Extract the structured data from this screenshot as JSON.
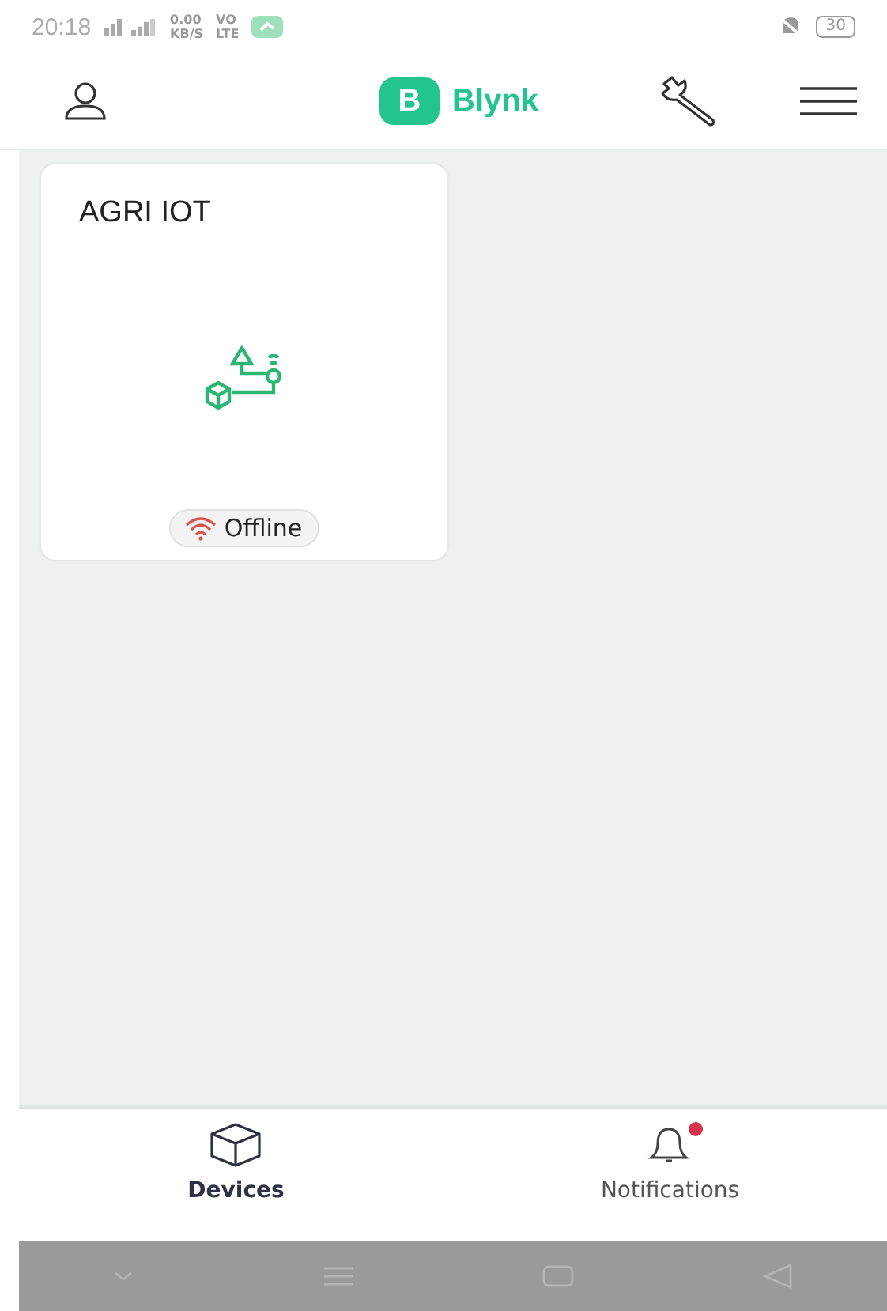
{
  "status_bar": {
    "time": "20:18",
    "speed": "0.00",
    "speed_unit": "KB/S",
    "volte": "VO",
    "volte_sub": "LTE",
    "battery": "30"
  },
  "header": {
    "logo_letter": "B",
    "logo_text": "Blynk"
  },
  "devices": [
    {
      "name": "AGRI IOT",
      "status": "Offline",
      "online": false
    }
  ],
  "tabs": [
    {
      "label": "Devices",
      "selected": true,
      "kind": "devices",
      "badge": false
    },
    {
      "label": "Notifications",
      "selected": false,
      "kind": "notifications",
      "badge": true
    }
  ]
}
